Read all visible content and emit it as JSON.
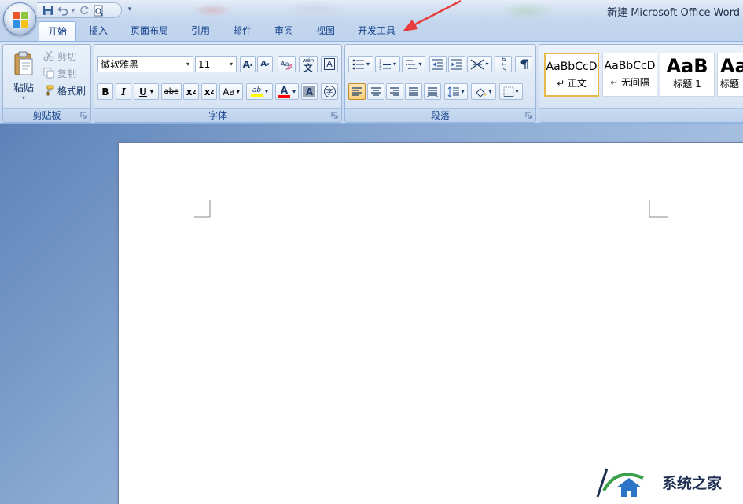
{
  "window": {
    "title": "新建 Microsoft Office Word"
  },
  "quick_access": {
    "items": [
      "save-icon",
      "undo-icon",
      "redo-icon",
      "print-preview-icon",
      "customize-dropdown-icon"
    ]
  },
  "tabs": [
    {
      "label": "开始",
      "active": true
    },
    {
      "label": "插入"
    },
    {
      "label": "页面布局"
    },
    {
      "label": "引用"
    },
    {
      "label": "邮件"
    },
    {
      "label": "审阅"
    },
    {
      "label": "视图"
    },
    {
      "label": "开发工具"
    }
  ],
  "clipboard": {
    "group_label": "剪贴板",
    "paste_label": "粘贴",
    "cut_label": "剪切",
    "copy_label": "复制",
    "format_painter_label": "格式刷"
  },
  "font": {
    "group_label": "字体",
    "font_name": "微软雅黑",
    "font_size": "11",
    "grow_label": "A",
    "shrink_label": "A",
    "clear_label": "A",
    "phonetic_label": "wén",
    "phonetic_char": "文",
    "border_char": "A",
    "bold_label": "B",
    "italic_label": "I",
    "underline_label": "U",
    "strike_label": "abe",
    "sub_label": "x",
    "sub_mark": "2",
    "sup_label": "x",
    "sup_mark": "2",
    "case_label": "Aa",
    "highlight_label": "ab",
    "font_color_label": "A",
    "shading_label": "A",
    "enclose_label": "字",
    "highlight_color": "#ffff00",
    "font_color": "#ff0000"
  },
  "paragraph": {
    "group_label": "段落",
    "buttons": [
      "bullets-icon",
      "numbering-icon",
      "multilevel-list-icon",
      "decrease-indent-icon",
      "increase-indent-icon",
      "chinese-layout-icon",
      "sort-icon",
      "show-marks-icon",
      "align-left-icon",
      "align-center-icon",
      "align-right-icon",
      "justify-icon",
      "distribute-icon",
      "line-spacing-icon",
      "shading-icon",
      "borders-icon"
    ],
    "sort_label": "A↓Z"
  },
  "styles": {
    "items": [
      {
        "sample": "AaBbCcD",
        "name": "↵ 正文",
        "selected": true
      },
      {
        "sample": "AaBbCcD",
        "name": "↵ 无间隔"
      },
      {
        "sample": "AaB",
        "name": "标题 1",
        "big": true
      },
      {
        "sample": "AaI",
        "name": "标题",
        "big": true
      }
    ]
  },
  "watermark": {
    "text": "系统之家"
  },
  "colors": {
    "accent": "#15428b",
    "annotation": "#e83b3b"
  }
}
